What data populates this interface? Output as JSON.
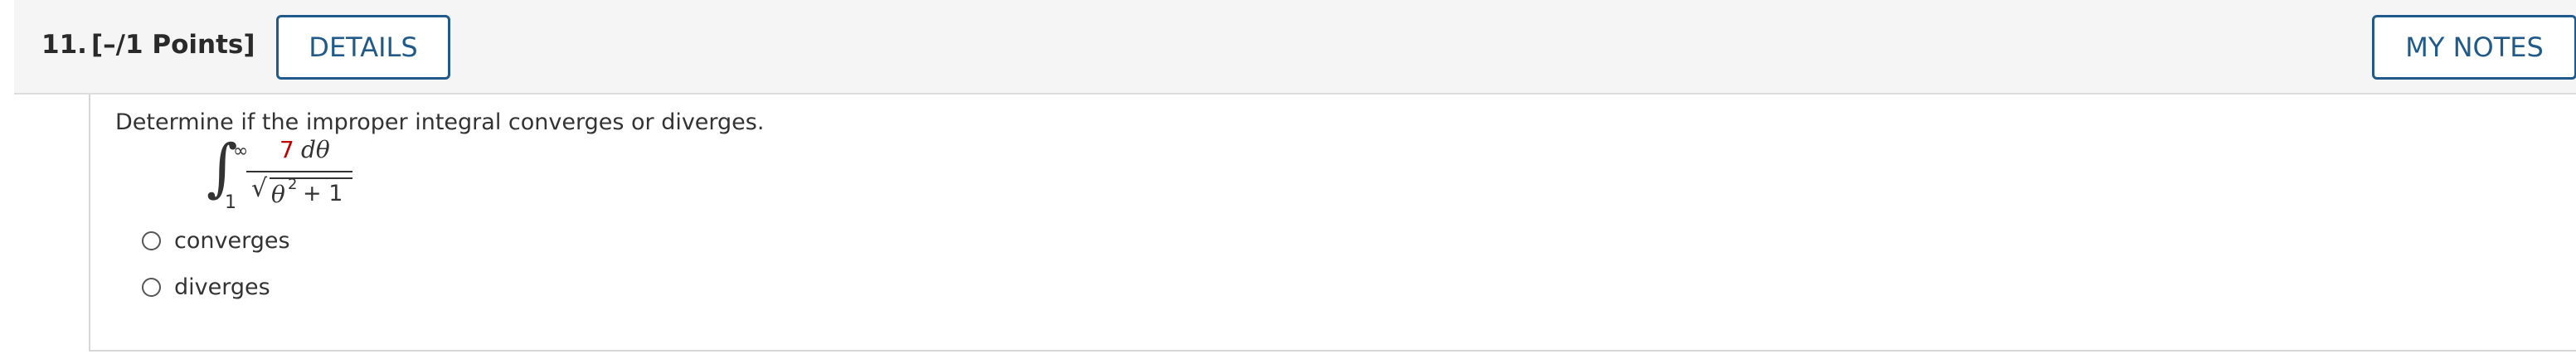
{
  "question": {
    "number": "11.",
    "points": "[–/1 Points]",
    "details_label": "DETAILS",
    "notes_label": "MY NOTES"
  },
  "content": {
    "prompt": "Determine if the improper integral converges or diverges.",
    "integral": {
      "upper_limit": "∞",
      "lower_limit": "1",
      "numerator_coefficient": "7",
      "numerator_rest": "dθ",
      "denominator_var": "θ",
      "denominator_exp": "2",
      "denominator_rest": "+ 1"
    },
    "options": [
      {
        "label": "converges"
      },
      {
        "label": "diverges"
      }
    ]
  },
  "colors": {
    "accent": "#1f5a8a",
    "highlight": "#c00000"
  }
}
